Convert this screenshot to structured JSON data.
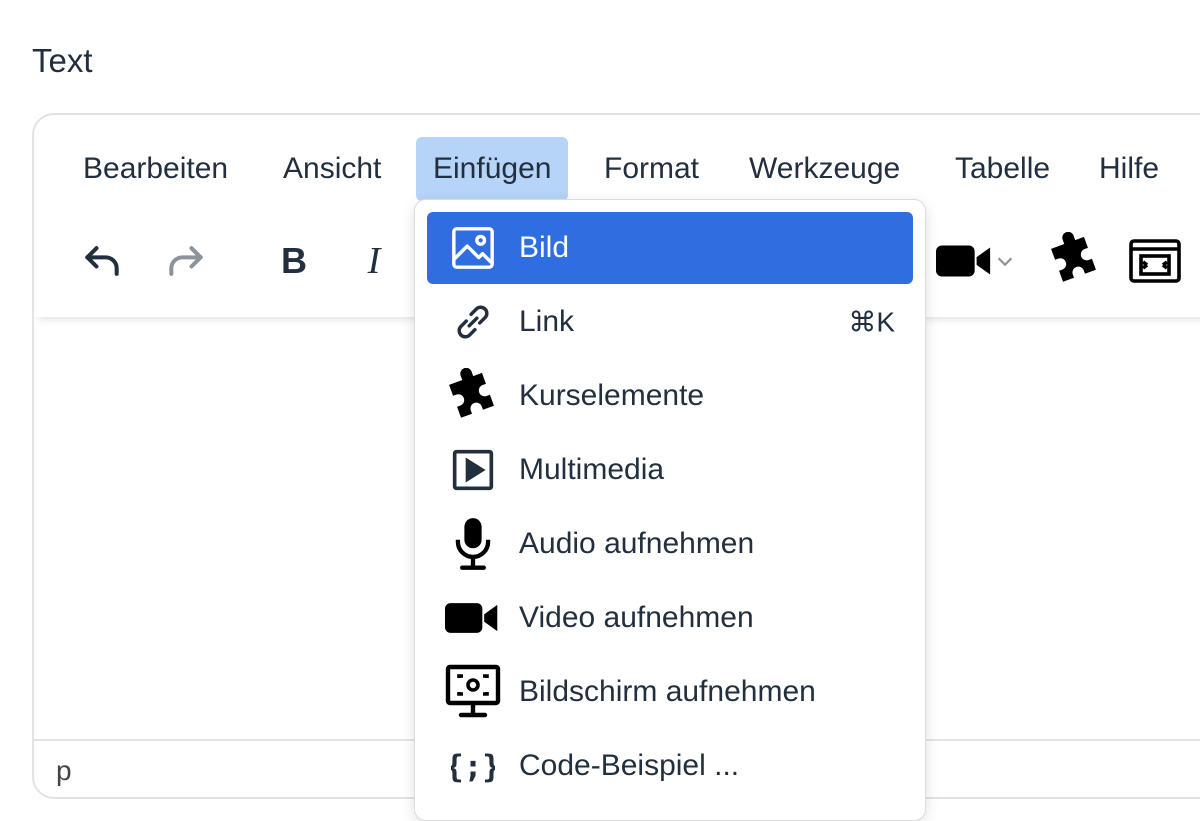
{
  "field": {
    "label": "Text"
  },
  "menubar": {
    "items": [
      {
        "label": "Bearbeiten"
      },
      {
        "label": "Ansicht"
      },
      {
        "label": "Einfügen",
        "active": true
      },
      {
        "label": "Format"
      },
      {
        "label": "Werkzeuge"
      },
      {
        "label": "Tabelle"
      },
      {
        "label": "Hilfe"
      }
    ]
  },
  "toolbar": {
    "buttons": [
      "undo-icon",
      "redo-icon",
      "bold-icon",
      "italic-icon",
      "video-icon",
      "puzzle-icon",
      "embed-icon"
    ],
    "bold_glyph": "B",
    "italic_glyph": "I"
  },
  "insert_menu": {
    "items": [
      {
        "label": "Bild",
        "icon": "image-icon",
        "selected": true
      },
      {
        "label": "Link",
        "icon": "link-icon",
        "shortcut": "⌘K"
      },
      {
        "label": "Kurselemente",
        "icon": "puzzle-icon"
      },
      {
        "label": "Multimedia",
        "icon": "multimedia-icon"
      },
      {
        "label": "Audio aufnehmen",
        "icon": "microphone-icon"
      },
      {
        "label": "Video aufnehmen",
        "icon": "video-camera-icon"
      },
      {
        "label": "Bildschirm aufnehmen",
        "icon": "screen-record-icon"
      },
      {
        "label": "Code-Beispiel ...",
        "icon": "code-braces-icon"
      }
    ]
  },
  "statusbar": {
    "path": "p"
  },
  "colors": {
    "accent": "#2f6ee0",
    "menu_active": "#b6d3f8",
    "text": "#222f3e"
  }
}
